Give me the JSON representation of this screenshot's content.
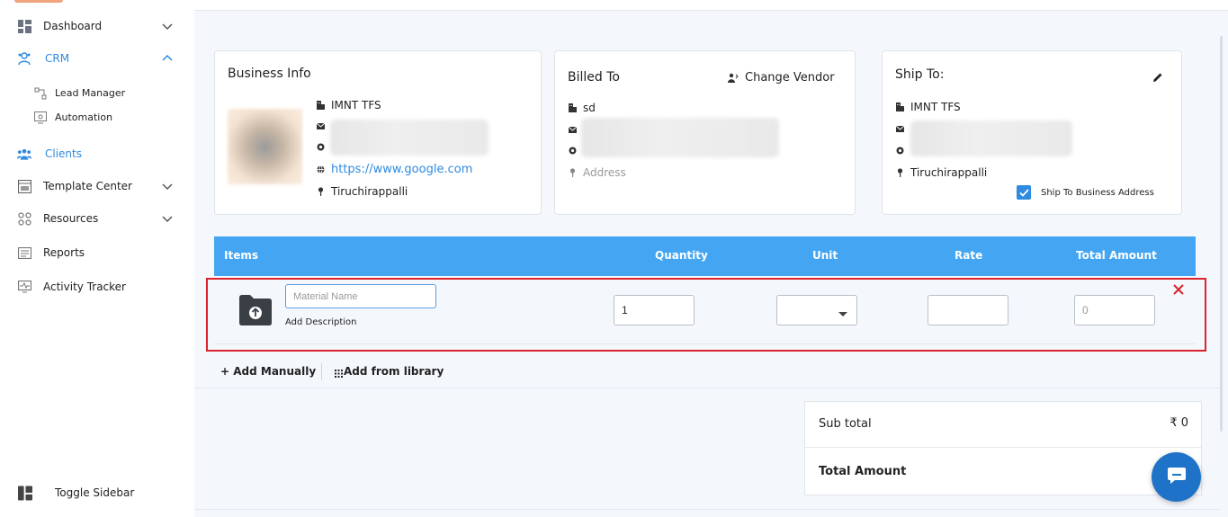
{
  "sidebar": {
    "items": [
      {
        "label": "Dashboard",
        "icon": "dashboard-icon"
      },
      {
        "label": "CRM",
        "icon": "crm-icon"
      },
      {
        "label": "Clients",
        "icon": "clients-icon"
      },
      {
        "label": "Template Center",
        "icon": "template-icon"
      },
      {
        "label": "Resources",
        "icon": "resources-icon"
      },
      {
        "label": "Reports",
        "icon": "reports-icon"
      },
      {
        "label": "Activity Tracker",
        "icon": "activity-icon"
      }
    ],
    "crm_sub": [
      {
        "label": "Lead Manager"
      },
      {
        "label": "Automation"
      }
    ],
    "toggle_label": "Toggle Sidebar"
  },
  "business_info": {
    "title": "Business Info",
    "name": "IMNT TFS",
    "website": "https://www.google.com",
    "city": "Tiruchirappalli"
  },
  "billed_to": {
    "title": "Billed To",
    "change_vendor": "Change Vendor",
    "name": "sd",
    "address_placeholder": "Address"
  },
  "ship_to": {
    "title": "Ship To:",
    "name": "IMNT TFS",
    "city": "Tiruchirappalli",
    "checkbox_label": "Ship To Business Address",
    "checkbox_checked": true
  },
  "table": {
    "headers": [
      "Items",
      "Quantity",
      "Unit",
      "Rate",
      "Total Amount"
    ],
    "row": {
      "material_placeholder": "Material Name",
      "add_description": "Add Description",
      "quantity": "1",
      "unit": "",
      "rate": "",
      "total": "0"
    }
  },
  "actions": {
    "add_manually": "+ Add Manually",
    "add_from_library": "Add from library"
  },
  "totals": {
    "subtotal_label": "Sub total",
    "subtotal_value": "₹ 0",
    "total_label": "Total Amount"
  },
  "colors": {
    "accent": "#2f8be0",
    "table_header": "#44a6f2",
    "highlight_border": "#d9232d",
    "chat_button": "#1e73c8"
  }
}
